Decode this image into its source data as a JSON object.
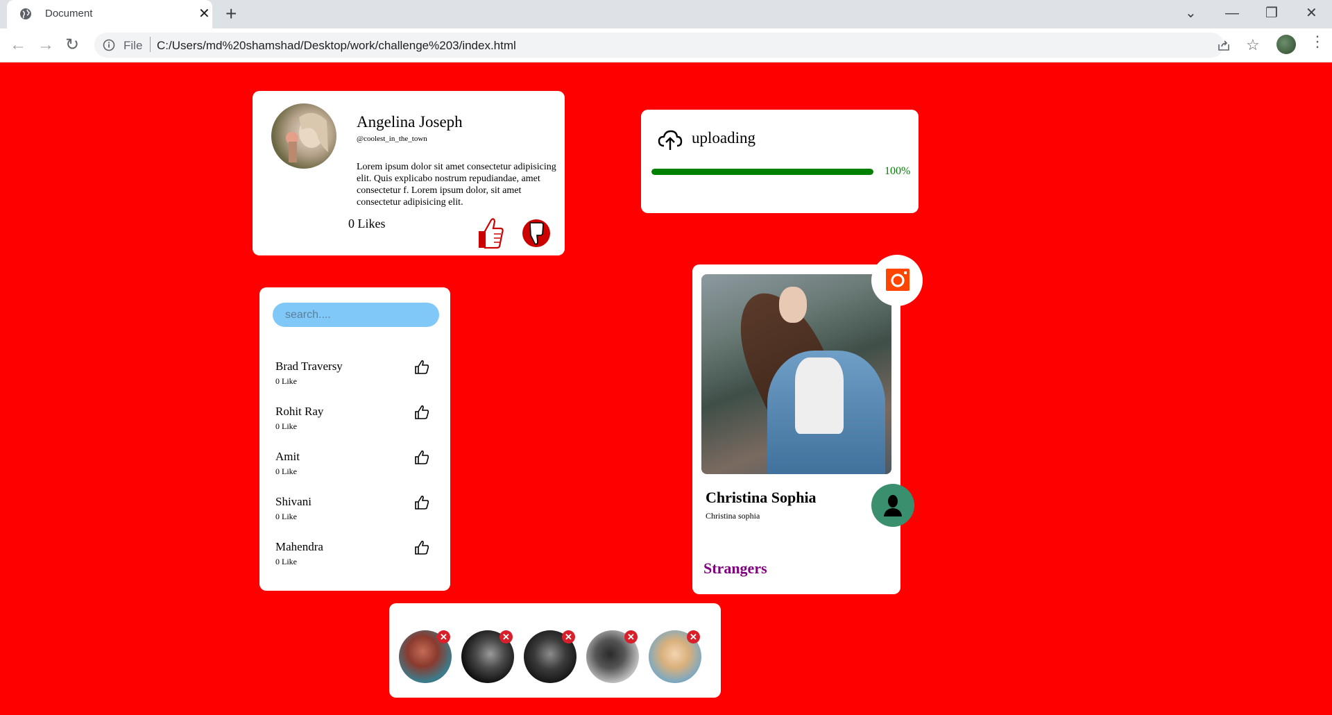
{
  "browser": {
    "tab_title": "Document",
    "tab_close": "✕",
    "new_tab": "+",
    "omnibox_scheme": "File",
    "url": "C:/Users/md%20shamshad/Desktop/work/challenge%203/index.html",
    "window_controls": [
      "⌄",
      "—",
      "❐",
      "✕"
    ]
  },
  "profile_card": {
    "name": "Angelina Joseph",
    "handle": "@coolest_in_the_town",
    "bio": "Lorem ipsum dolor sit amet consectetur adipisicing elit. Quis explicabo nostrum repudiandae, amet consectetur f. Lorem ipsum dolor, sit amet consectetur adipisicing elit.",
    "likes": "0 Likes",
    "colors": {
      "thumb_up": "#cc0000",
      "thumb_down": "#cc0000"
    }
  },
  "upload_card": {
    "title": "uploading",
    "progress": 1.0,
    "percent_label": "100%",
    "color": "#008000"
  },
  "people_card": {
    "search_placeholder": "search....",
    "people": [
      {
        "name": "Brad Traversy",
        "likes": "0 Like"
      },
      {
        "name": "Rohit Ray",
        "likes": "0 Like"
      },
      {
        "name": "Amit",
        "likes": "0 Like"
      },
      {
        "name": "Shivani",
        "likes": "0 Like"
      },
      {
        "name": "Mahendra",
        "likes": "0 Like"
      }
    ]
  },
  "christina_card": {
    "name": "Christina Sophia",
    "subtitle": "Christina sophia",
    "footer": "Strangers",
    "colors": {
      "camera": "#ff4500",
      "user_badge": "#3a8f6e",
      "footer": "#800080"
    }
  },
  "stories_card": {
    "remove_glyph": "✕",
    "story_count": 5
  },
  "page_background": "#ff0000"
}
